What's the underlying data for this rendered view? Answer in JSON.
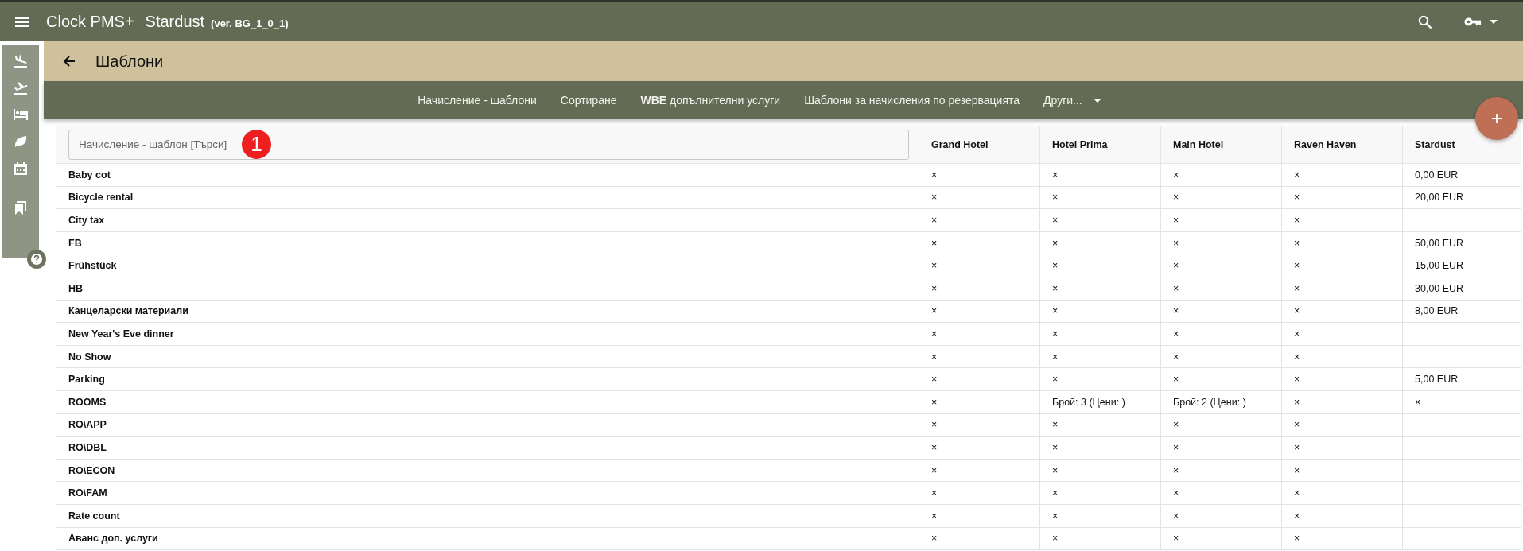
{
  "app_bar": {
    "app_name": "Clock PMS+",
    "property": "Stardust",
    "version": "(ver. BG_1_0_1)"
  },
  "page_title": "Шаблони",
  "tabs": [
    {
      "label": "Начисление - шаблони"
    },
    {
      "label": "Сортиране"
    },
    {
      "label": "**WBE** допълнителни услуги"
    },
    {
      "label": "Шаблони за начисления по резервацията"
    },
    {
      "label": "Други...",
      "kind": "dropdown"
    }
  ],
  "search": {
    "placeholder": "Начисление - шаблон [Търси]",
    "badge": "1"
  },
  "table": {
    "columns": [
      "Grand Hotel",
      "Hotel Prima",
      "Main Hotel",
      "Raven Haven",
      "Stardust"
    ],
    "rows": [
      {
        "name": "Baby cot",
        "cells": [
          "×",
          "×",
          "×",
          "×",
          "0,00 EUR"
        ]
      },
      {
        "name": "Bicycle rental",
        "cells": [
          "×",
          "×",
          "×",
          "×",
          "20,00 EUR"
        ]
      },
      {
        "name": "City tax",
        "cells": [
          "×",
          "×",
          "×",
          "×",
          null
        ]
      },
      {
        "name": "FB",
        "cells": [
          "×",
          "×",
          "×",
          "×",
          "50,00 EUR"
        ]
      },
      {
        "name": "Frühstück",
        "cells": [
          "×",
          "×",
          "×",
          "×",
          "15,00 EUR"
        ]
      },
      {
        "name": "HB",
        "cells": [
          "×",
          "×",
          "×",
          "×",
          "30,00 EUR"
        ]
      },
      {
        "name": "Канцеларски материали",
        "cells": [
          "×",
          "×",
          "×",
          "×",
          "8,00 EUR"
        ]
      },
      {
        "name": "New Year's Eve dinner",
        "cells": [
          "×",
          "×",
          "×",
          "×",
          null
        ]
      },
      {
        "name": "No Show",
        "cells": [
          "×",
          "×",
          "×",
          "×",
          null
        ]
      },
      {
        "name": "Parking",
        "cells": [
          "×",
          "×",
          "×",
          "×",
          "5,00 EUR"
        ]
      },
      {
        "name": "ROOMS",
        "cells": [
          "×",
          "Брой: 3 (Цени: )",
          "Брой: 2 (Цени: )",
          "×",
          "×"
        ]
      },
      {
        "name": "RO\\APP",
        "cells": [
          "×",
          "×",
          "×",
          "×",
          null
        ]
      },
      {
        "name": "RO\\DBL",
        "cells": [
          "×",
          "×",
          "×",
          "×",
          null
        ]
      },
      {
        "name": "RO\\ECON",
        "cells": [
          "×",
          "×",
          "×",
          "×",
          null
        ]
      },
      {
        "name": "RO\\FAM",
        "cells": [
          "×",
          "×",
          "×",
          "×",
          null
        ]
      },
      {
        "name": "Rate count",
        "cells": [
          "×",
          "×",
          "×",
          "×",
          null
        ]
      },
      {
        "name": "Аванс доп. услуги",
        "cells": [
          "×",
          "×",
          "×",
          "×",
          null
        ]
      }
    ]
  }
}
